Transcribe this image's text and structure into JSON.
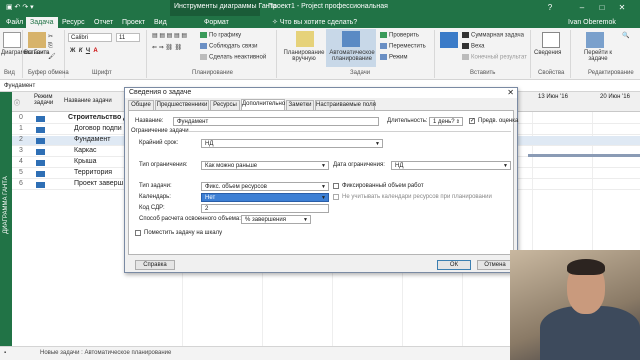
{
  "window": {
    "ctx_label": "Инструменты диаграммы Ганта",
    "app_title": "Проект1 - Project профессиональная",
    "user": "Ivan Oberemok",
    "help": "?",
    "min": "–",
    "max": "□",
    "close": "✕"
  },
  "tabs": [
    "Файл",
    "Задача",
    "Ресурс",
    "Отчет",
    "Проект",
    "Вид",
    "Формат"
  ],
  "tell_me": "Что вы хотите сделать?",
  "ribbon": {
    "gantt": "Диаграмма Ганта",
    "paste": "Вставить",
    "font": "Calibri",
    "size": "11",
    "by_schedule": "По графику",
    "respect_links": "Соблюдать связи",
    "make_inactive": "Сделать неактивной",
    "manual": "Планирование вручную",
    "auto": "Автоматическое планирование",
    "inspect": "Проверить",
    "move": "Переместить",
    "mode": "Режим",
    "summary": "Суммарная задача",
    "milestone": "Веха",
    "deliverable": "Конечный результат",
    "info": "Сведения",
    "scroll": "Перейти к задаче",
    "groups": [
      "Вид",
      "Буфер обмена",
      "Шрифт",
      "Планирование",
      "Задачи",
      "Вставить",
      "Свойства",
      "Редактирование"
    ]
  },
  "formula_value": "Фундамент",
  "sidebar_label": "ДИАГРАММА ГАНТА",
  "grid": {
    "col_mode": "Режим задачи",
    "col_name": "Название задачи",
    "week1": "13 Июн '16",
    "week2": "20 Июн '16",
    "rows": [
      {
        "num": "0",
        "name": "Строительство д",
        "bold": true
      },
      {
        "num": "1",
        "name": "Договор подпи"
      },
      {
        "num": "2",
        "name": "Фундамент"
      },
      {
        "num": "3",
        "name": "Каркас"
      },
      {
        "num": "4",
        "name": "Крыша"
      },
      {
        "num": "5",
        "name": "Территория"
      },
      {
        "num": "6",
        "name": "Проект заверш"
      }
    ]
  },
  "status": {
    "left": "Новые задачи : Автоматическое планирование"
  },
  "dialog": {
    "title": "Сведения о задаче",
    "tabs": [
      "Общие",
      "Предшественники",
      "Ресурсы",
      "Дополнительно",
      "Заметки",
      "Настраиваемые поля"
    ],
    "name_label": "Название:",
    "name_value": "Фундамент",
    "duration_label": "Длительность:",
    "duration_value": "1 день?",
    "estimated_label": "Предв. оценка",
    "section_constraint": "Ограничение задачи",
    "deadline_label": "Крайний срок:",
    "deadline_value": "НД",
    "ctype_label": "Тип ограничения:",
    "ctype_value": "Как можно раньше",
    "cdate_label": "Дата ограничения:",
    "cdate_value": "НД",
    "tasktype_label": "Тип задачи:",
    "tasktype_value": "Фикс. объем ресурсов",
    "effort_label": "Фиксированный объем работ",
    "calendar_label": "Календарь:",
    "calendar_value": "Нет",
    "ignore_cal_label": "Не учитывать календари ресурсов при планировании",
    "wbs_label": "Код СДР:",
    "wbs_value": "2",
    "earned_label": "Способ расчета освоенного объема:",
    "earned_value": "% завершения",
    "timeline_label": "Поместить задачу на шкалу",
    "help_btn": "Справка",
    "ok_btn": "ОК",
    "cancel_btn": "Отмена"
  }
}
